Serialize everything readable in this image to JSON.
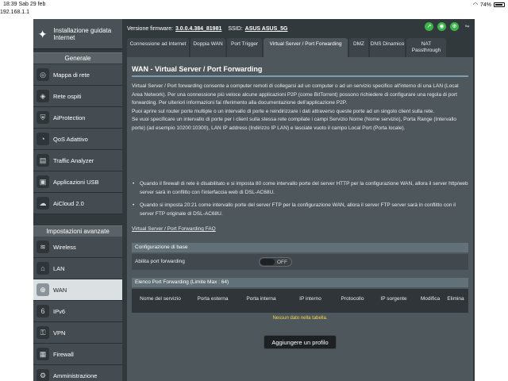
{
  "status_bar": {
    "time": "18:39",
    "date": "Sab 29 feb",
    "url": "192.168.1.1",
    "battery": "74%",
    "battery_level": 0.74
  },
  "sidebar": {
    "qis_label": "Installazione guidata Internet",
    "general_title": "Generale",
    "general_items": [
      {
        "label": "Mappa di rete",
        "icon": "network-map-icon"
      },
      {
        "label": "Rete ospiti",
        "icon": "guest-network-icon"
      },
      {
        "label": "AiProtection",
        "icon": "shield-icon"
      },
      {
        "label": "QoS Adattivo",
        "icon": "speedometer-icon"
      },
      {
        "label": "Traffic Analyzer",
        "icon": "chart-icon"
      },
      {
        "label": "Applicazioni USB",
        "icon": "puzzle-icon"
      },
      {
        "label": "AiCloud 2.0",
        "icon": "cloud-icon"
      }
    ],
    "advanced_title": "Impostazioni avanzate",
    "advanced_items": [
      {
        "label": "Wireless",
        "icon": "wifi-icon"
      },
      {
        "label": "LAN",
        "icon": "home-icon"
      },
      {
        "label": "WAN",
        "icon": "globe-icon",
        "active": true
      },
      {
        "label": "IPv6",
        "icon": "ipv6-icon"
      },
      {
        "label": "VPN",
        "icon": "vpn-icon"
      },
      {
        "label": "Firewall",
        "icon": "firewall-icon"
      },
      {
        "label": "Amministrazione",
        "icon": "admin-icon"
      }
    ]
  },
  "top_info": {
    "firmware_label": "Versione firmware:",
    "firmware_value": "3.0.0.4.384_81981",
    "ssid_label": "SSID:",
    "ssid_value": "ASUS  ASUS_5G"
  },
  "tabs": [
    "Connessione ad Internet",
    "Doppia WAN",
    "Port Trigger",
    "Virtual Server / Port Forwarding",
    "DMZ",
    "DNS Dinamico",
    "NAT Passthrough"
  ],
  "page": {
    "title": "WAN - Virtual Server / Port Forwarding",
    "description_1": "Virtual Server / Port forwarding consente a computer remoti di collegarsi ad un computer o ad un servizio specifico all'interno di una LAN (Local Area Network). Per una connessione più veloce alcune applicazioni P2P (come BitTorrent) possono richiedere di configurare una regola di port forwarding. Per ulteriori informazioni fai riferimento alla documentazione dell'applicazione P2P.",
    "description_2": "Puoi aprire sul router porte multiple o un intervallo di porte e reindirizzare i dati attraverso queste porte ad un singolo client sulla rete.",
    "description_3": "Se vuoi specificare un intervallo di porte per i client sulla stessa rete compilate i campi Servizio Nome (Nome servizio), Porta Range (Intervallo porte) (ad esempio 10200:10300), LAN IP address (Indirizzo IP LAN) e lasciate vuoto il campo Local Port (Porta locale).",
    "bullet_1": "Quando il firewall di rete è disabilitato e si imposta 80 come intervallo porte del server HTTP per la configurazione WAN, allora il server http/web server sarà in conflitto con l'interfaccia web di DSL-AC68U.",
    "bullet_2": "Quando si imposta 20:21 come intervallo porte del server FTP per la configurazione WAN, allora il server FTP server sarà in conflitto con il server FTP originale di DSL-AC68U.",
    "faq_link": "Virtual Server / Port Forwarding FAQ"
  },
  "basic_config": {
    "title": "Configurazione di base",
    "enable_label": "Abilita port forwarding",
    "toggle_text": "OFF",
    "enabled": false
  },
  "list": {
    "title": "Elenco Port Forwarding (Limite Max : 64)",
    "columns": [
      "Nome del servizio",
      "Porta esterna",
      "Porta interna",
      "IP interno",
      "Protocollo",
      "IP sorgente",
      "Modifica",
      "Elimina"
    ],
    "empty_text": "Nessun dato nella tabella.",
    "add_button": "Aggiungere un profilo"
  }
}
